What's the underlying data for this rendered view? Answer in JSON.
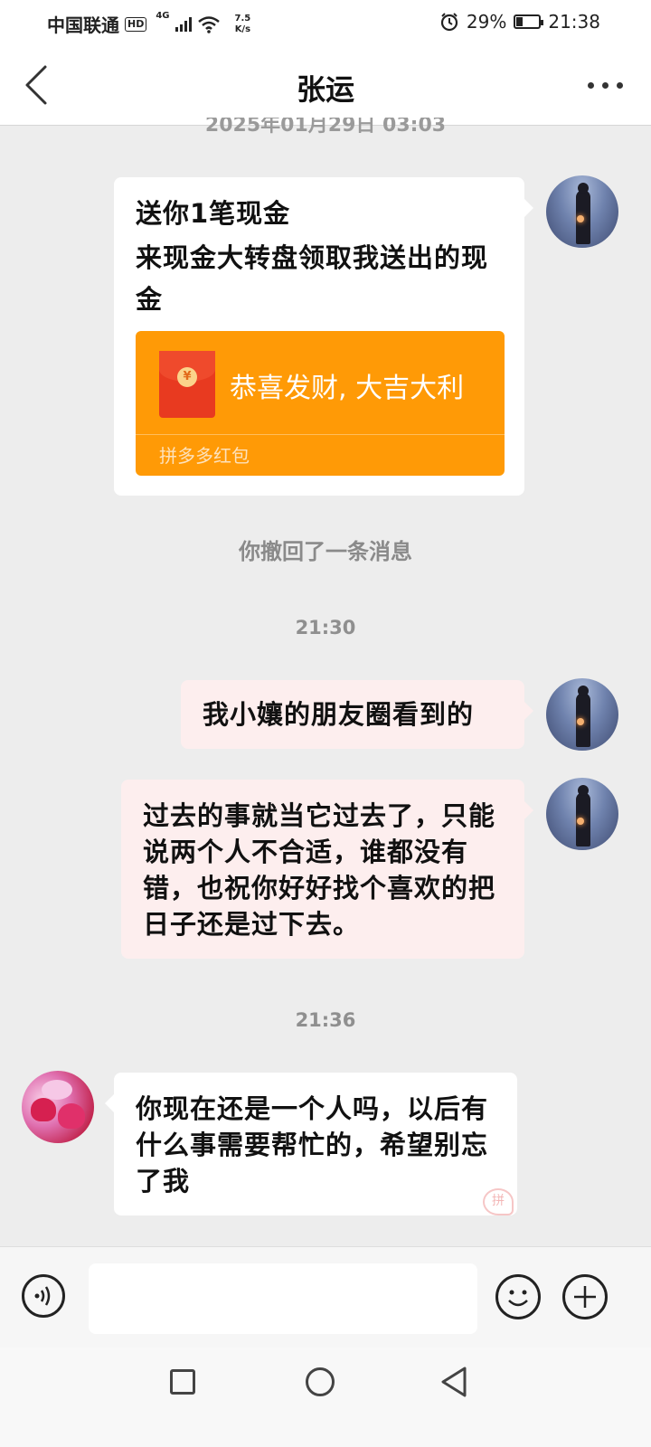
{
  "status_bar": {
    "carrier": "中国联通",
    "hd": "HD",
    "network": "4G",
    "speed_value": "7.5",
    "speed_unit": "K/s",
    "battery": "29%",
    "battery_level": 0.29,
    "time": "21:38"
  },
  "header": {
    "title": "张运"
  },
  "top_timestamp": "2025年01月29日 03:03",
  "messages": {
    "m1_line1": "送你1笔现金",
    "m1_line2": "来现金大转盘领取我送出的现金",
    "hongbao_greeting": "恭喜发财, 大吉大利",
    "hongbao_label": "拼多多红包",
    "hongbao_coin": "¥",
    "recall": "你撤回了一条消息",
    "ts1": "21:30",
    "m2": "我小孃的朋友圈看到的",
    "m3": "过去的事就当它过去了，只能说两个人不合适，谁都没有错，也祝你好好找个喜欢的把日子还是过下去。",
    "ts2": "21:36",
    "m4": "你现在还是一个人吗，以后有什么事需要帮忙的，希望别忘了我",
    "stamp": "拼"
  },
  "input": {
    "placeholder": ""
  },
  "colors": {
    "hongbao_orange": "#ff9a06",
    "bubble_pink": "#fdeeee",
    "background": "#ededed"
  }
}
